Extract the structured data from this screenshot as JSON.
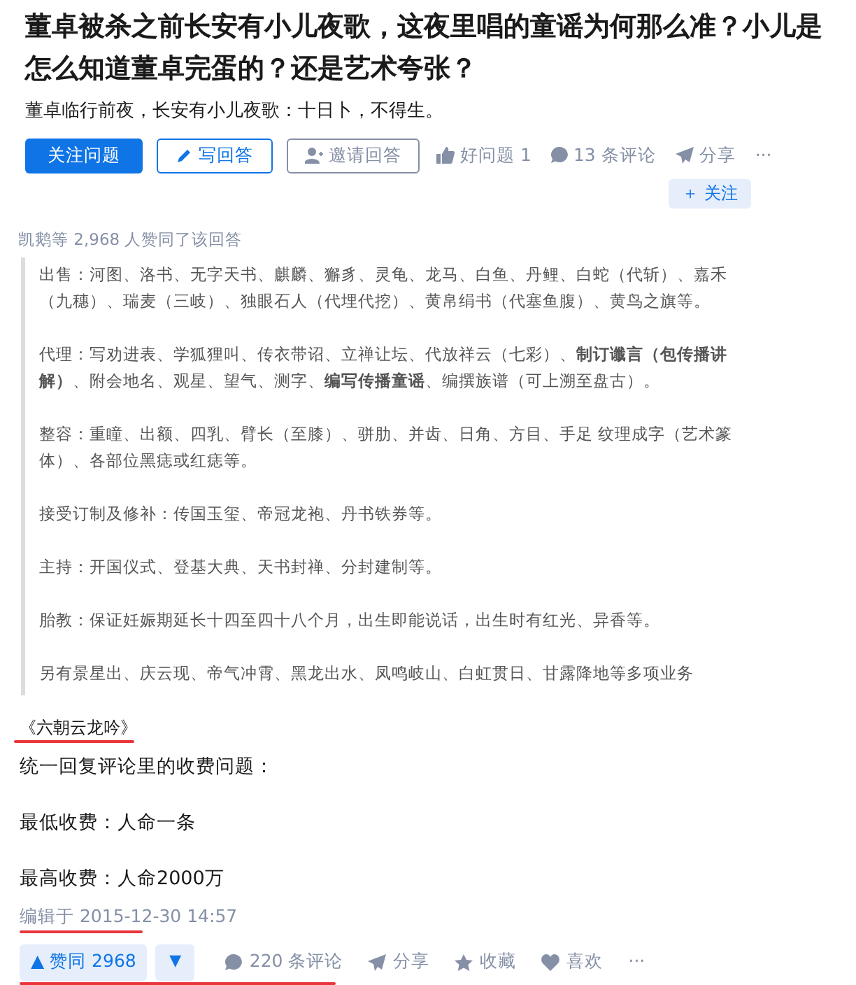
{
  "question": {
    "title": "董卓被杀之前长安有小儿夜歌，这夜里唱的童谣为何那么准？小儿是怎么知道董卓完蛋的？还是艺术夸张？",
    "detail": "董卓临行前夜，长安有小儿夜歌：十日卜，不得生。"
  },
  "actions": [
    {
      "kind": "primary",
      "label": "关注问题"
    },
    {
      "kind": "outline",
      "label": "写回答"
    },
    {
      "kind": "ghost",
      "label": "邀请回答"
    },
    {
      "kind": "plain",
      "label": "好问题 1"
    },
    {
      "kind": "plain",
      "label": "13 条评论"
    },
    {
      "kind": "plain",
      "label": "分享"
    },
    {
      "kind": "plain",
      "label": "···"
    }
  ],
  "follow_button": "＋ 关注",
  "voters": "凯鹅等 2,968 人赞同了该回答",
  "quote": [
    "出售：河图、洛书、无字天书、麒麟、獬豸、灵龟、龙马、白鱼、丹鲤、白蛇（代斩）、嘉禾（九穗）、瑞麦（三岐）、独眼石人（代埋代挖）、黄帛绢书（代塞鱼腹）、黄鸟之旗等。",
    "代理：写劝进表、学狐狸叫、传衣带诏、立禅让坛、代放祥云（七彩）、**制订谶言（包传播讲解）**、附会地名、观星、望气、测字、**编写传播童谣**、编撰族谱（可上溯至盘古）。",
    "整容：重瞳、出额、四乳、臂长（至膝）、骈肋、并齿、日角、方目、手足 纹理成字（艺术篆体）、各部位黑痣或红痣等。",
    "接受订制及修补：传国玉玺、帝冠龙袍、丹书铁券等。",
    "主持：开国仪式、登基大典、天书封禅、分封建制等。",
    "胎教：保证妊娠期延长十四至四十八个月，出生即能说话，出生时有红光、异香等。",
    "另有景星出、庆云现、帝气冲霄、黑龙出水、凤鸣岐山、白虹贯日、甘露降地等多项业务"
  ],
  "source": {
    "text": "《六朝云龙吟》",
    "underlined": true
  },
  "body": [
    "统一回复评论里的收费问题：",
    "最低收费：人命一条",
    "最高收费：人命2000万"
  ],
  "edited": {
    "text": "编辑于 2015-12-30 14:57",
    "underlined": true
  },
  "footer": {
    "underlined": true,
    "vote_up": "▲ 赞同 2968",
    "vote_down": "▼",
    "items": [
      {
        "label": "220 条评论"
      },
      {
        "label": "分享"
      },
      {
        "label": "收藏"
      },
      {
        "label": "喜欢"
      },
      {
        "label": "···"
      }
    ]
  }
}
